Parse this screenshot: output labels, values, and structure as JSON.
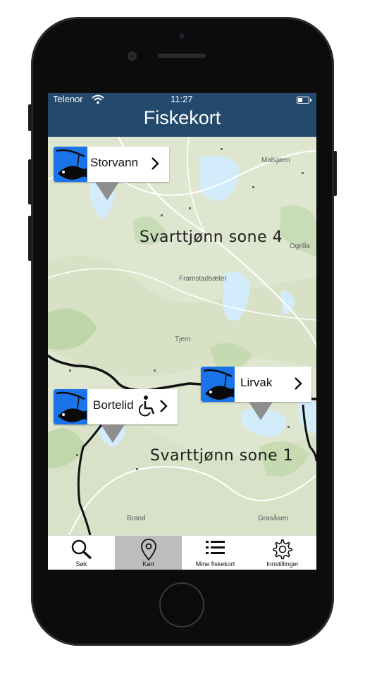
{
  "status_bar": {
    "carrier": "Telenor",
    "time": "11:27"
  },
  "header": {
    "title": "Fiskekort"
  },
  "map": {
    "zones": [
      "Svarttjønn sone 4",
      "Svarttjønn sone 1"
    ],
    "places": [
      "Malsjøen",
      "Ogrilla",
      "Framstadsæter",
      "Tjern",
      "Brand",
      "Grasåsen"
    ]
  },
  "markers": [
    {
      "name": "Storvann"
    },
    {
      "name": "Bortelid",
      "accessibility": "wheelchair-icon"
    },
    {
      "name": "Lirvak"
    }
  ],
  "tabbar": {
    "active": "Kart",
    "tabs": [
      {
        "label": "Søk",
        "icon": "search-icon"
      },
      {
        "label": "Kart",
        "icon": "map-pin-icon"
      },
      {
        "label": "Mine fiskekort",
        "icon": "list-icon"
      },
      {
        "label": "Innstillinger",
        "icon": "gear-icon"
      }
    ]
  },
  "colors": {
    "nav": "#23496d",
    "accent": "#1a73e8",
    "map_bg": "#dfe6cf",
    "water": "#d3ecfb"
  }
}
